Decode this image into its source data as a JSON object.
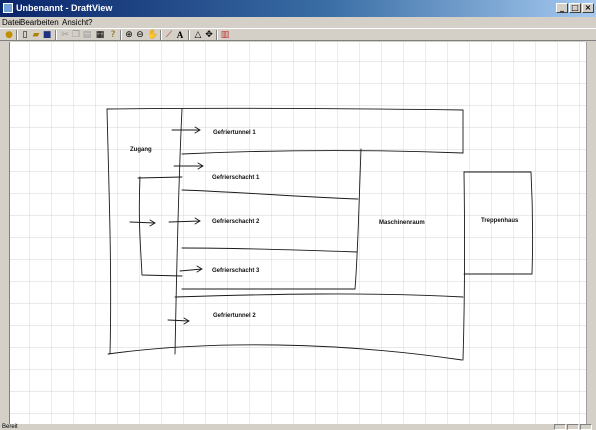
{
  "window": {
    "title": "Unbenannt - DraftView"
  },
  "menu": {
    "items": [
      "Datei",
      "Bearbeiten",
      "Ansicht",
      "?"
    ]
  },
  "canvas": {
    "labels": {
      "zugang": "Zugang",
      "gefriertunnel_1": "Gefriertunnel 1",
      "gefrierschacht_1": "Gefrierschacht 1",
      "gefrierschacht_2": "Gefrierschacht 2",
      "gefrierschacht_3": "Gefrierschacht 3",
      "gefriertunnel_2": "Gefriertunnel 2",
      "maschinenraum": "Maschinenraum",
      "treppenhaus": "Treppenhaus"
    }
  },
  "statusbar": {
    "text": "Bereit"
  }
}
